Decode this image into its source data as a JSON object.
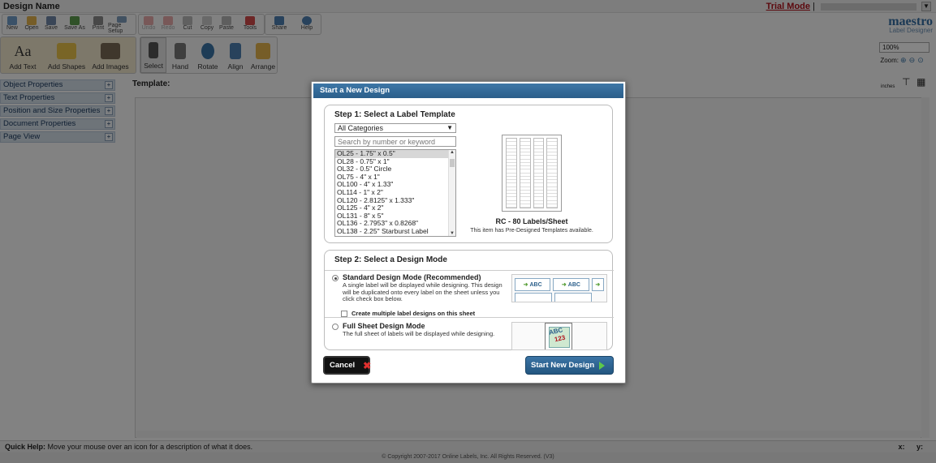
{
  "app": {
    "title": "Design Name",
    "trial_mode": "Trial Mode",
    "separator": "|",
    "logo_main": "maestro",
    "logo_sub": "Label Designer",
    "zoom_value": "100%",
    "zoom_label": "Zoom:",
    "units_label": "inches",
    "template_label": "Template:",
    "quick_help_label": "Quick Help:",
    "quick_help_text": "Move your mouse over an icon for a description of what it does.",
    "coord_x": "x:",
    "coord_y": "y:",
    "copyright": "© Copyright 2007-2017 Online Labels, Inc. All Rights Reserved. (V3)"
  },
  "toolbar": {
    "file": [
      "New",
      "Open",
      "Save",
      "Save As",
      "Print",
      "Page Setup"
    ],
    "edit": [
      "Undo",
      "Redo",
      "Cut",
      "Copy",
      "Paste",
      "Tools"
    ],
    "other": [
      "Share",
      "Help"
    ]
  },
  "ribbon": {
    "add": [
      "Add Text",
      "Add Shapes",
      "Add Images"
    ],
    "tools": [
      "Select",
      "Hand",
      "Rotate",
      "Align",
      "Arrange"
    ]
  },
  "sidebar": {
    "panels": [
      "Object Properties",
      "Text Properties",
      "Position and Size Properties",
      "Document Properties",
      "Page View"
    ]
  },
  "modal": {
    "title": "Start a New Design",
    "step1": {
      "title": "Step 1: Select a Label Template",
      "category": "All Categories",
      "search_placeholder": "Search by number or keyword",
      "templates": [
        "OL25 - 1.75\" x 0.5\"",
        "OL28 - 0.75\" x 1\"",
        "OL32 - 0.5\" Circle",
        "OL75 - 4\" x 1\"",
        "OL100 - 4\" x 1.33\"",
        "OL114 - 1\" x 2\"",
        "OL120 - 2.8125\" x 1.333\"",
        "OL125 - 4\" x 2\"",
        "OL131 - 8\" x 5\"",
        "OL136 - 2.7953\" x 0.8268\"",
        "OL138 - 2.25\" Starburst Label"
      ],
      "selected_index": 0,
      "sheet_name": "RC - 80 Labels/Sheet",
      "sheet_note": "This item has Pre-Designed Templates available."
    },
    "step2": {
      "title": "Step 2: Select a Design Mode",
      "standard_title": "Standard Design Mode (Recommended)",
      "standard_desc": "A single label will be displayed while designing. This design will be duplicated onto every label on the sheet unless you click check box below.",
      "multiple_checkbox": "Create multiple label designs on this sheet",
      "full_title": "Full Sheet Design Mode",
      "full_desc": "The full sheet of labels will be displayed while designing.",
      "sample_text": "ABC",
      "sample_num": "123"
    },
    "cancel": "Cancel",
    "start": "Start New Design"
  }
}
